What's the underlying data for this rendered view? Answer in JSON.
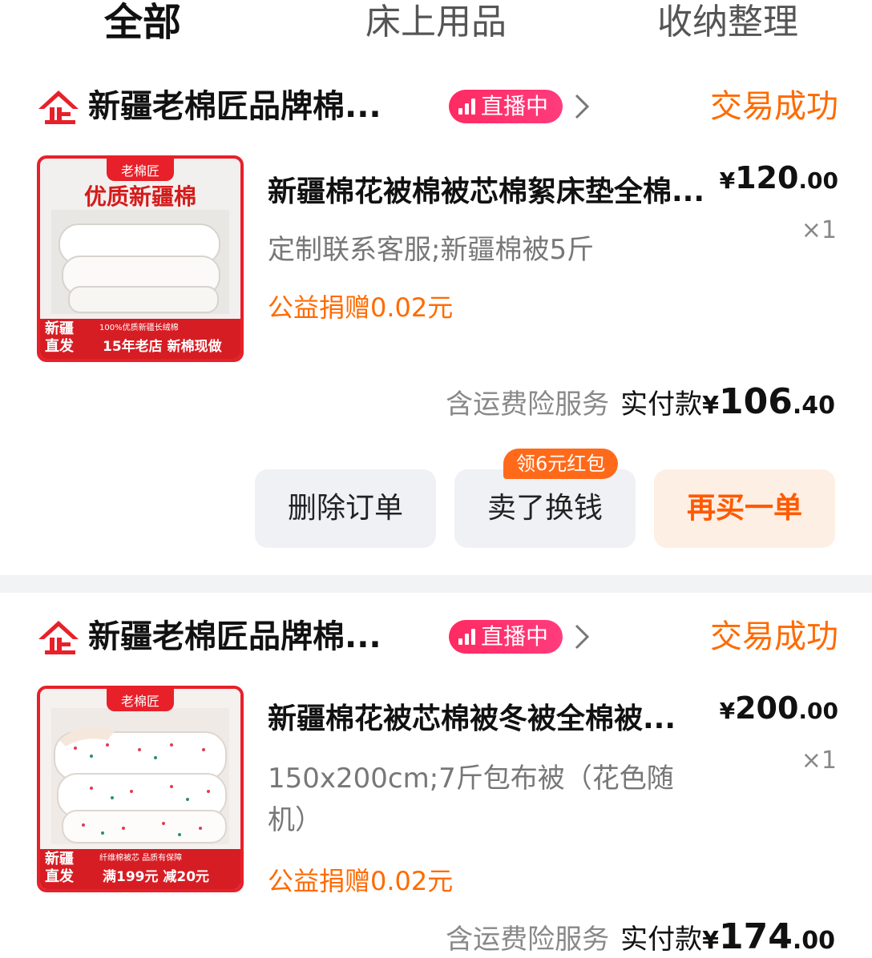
{
  "tabs": [
    {
      "label": "全部",
      "active": true
    },
    {
      "label": "床上用品",
      "active": false
    },
    {
      "label": "收纳整理",
      "active": false
    }
  ],
  "orders": [
    {
      "shop": {
        "logo_icon": "enterprise-shop-icon",
        "name": "新疆老棉匠品牌棉...",
        "live_label": "直播中"
      },
      "status": "交易成功",
      "product": {
        "image_icon": "cotton-quilt-product-image",
        "image_texts": {
          "brand": "老棉匠",
          "headline": "优质新疆棉",
          "origin": "新疆直发",
          "small": "100%优质新疆长绒棉",
          "promo": "15年老店 新棉现做"
        },
        "title": "新疆棉花被棉被芯棉絮床垫全棉...",
        "spec": "定制联系客服;新疆棉被5斤",
        "donation": "公益捐赠0.02元",
        "price_yen": "¥",
        "price_int": "120",
        "price_cents": ".00",
        "qty": "×1"
      },
      "total": {
        "service": "含运费险服务",
        "label": "实付款",
        "yen": "¥",
        "int": "106",
        "cents": ".40"
      },
      "buttons": {
        "delete": "删除订单",
        "sell": "卖了换钱",
        "sell_badge": "领6元红包",
        "rebuy": "再买一单"
      }
    },
    {
      "shop": {
        "logo_icon": "enterprise-shop-icon",
        "name": "新疆老棉匠品牌棉...",
        "live_label": "直播中"
      },
      "status": "交易成功",
      "product": {
        "image_icon": "dotted-quilt-product-image",
        "image_texts": {
          "brand": "老棉匠",
          "origin": "新疆直发",
          "small": "纤维棉被芯 品质有保障",
          "promo": "满199元 减20元"
        },
        "title": "新疆棉花被芯棉被冬被全棉被...",
        "spec": "150x200cm;7斤包布被（花色随机）",
        "donation": "公益捐赠0.02元",
        "price_yen": "¥",
        "price_int": "200",
        "price_cents": ".00",
        "qty": "×1"
      },
      "total": {
        "service": "含运费险服务",
        "label": "实付款",
        "yen": "¥",
        "int": "174",
        "cents": ".00"
      }
    }
  ],
  "colors": {
    "accent": "#ff6a00",
    "live": "#ff2a62",
    "brand_red": "#e8202a"
  }
}
